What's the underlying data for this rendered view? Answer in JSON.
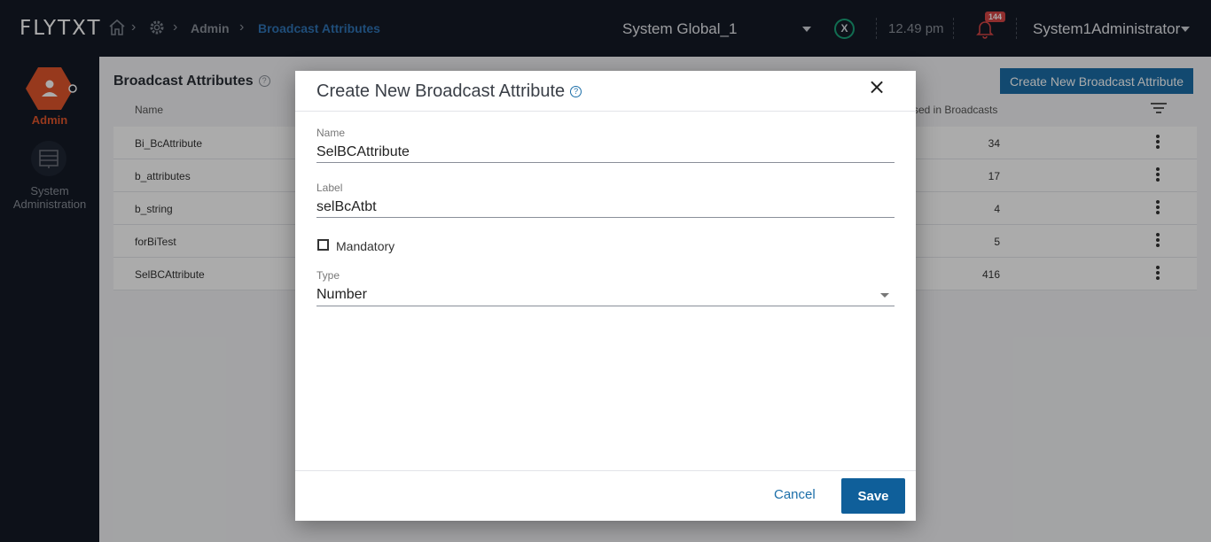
{
  "header": {
    "logo": "FLYTXT",
    "breadcrumb": {
      "admin": "Admin",
      "current": "Broadcast Attributes"
    },
    "tenant": "System Global_1",
    "status_badge": "X",
    "time": "12.49 pm",
    "notification_count": "144",
    "user": "System1Administrator"
  },
  "sidebar": {
    "items": [
      {
        "label": "Admin"
      },
      {
        "label": "System Administration"
      }
    ]
  },
  "page": {
    "title": "Broadcast Attributes",
    "help": "?",
    "create_button": "Create New Broadcast Attribute",
    "columns": {
      "name": "Name",
      "used_in": "sed in Broadcasts"
    },
    "rows": [
      {
        "name": "Bi_BcAttribute",
        "count": "34"
      },
      {
        "name": "b_attributes",
        "count": "17"
      },
      {
        "name": "b_string",
        "count": "4"
      },
      {
        "name": "forBiTest",
        "count": "5"
      },
      {
        "name": "SelBCAttribute",
        "count": "416"
      }
    ]
  },
  "modal": {
    "title": "Create New Broadcast Attribute",
    "help": "?",
    "close": "×",
    "name_label": "Name",
    "name_value": "SelBCAttribute",
    "label_label": "Label",
    "label_value": "selBcAtbt",
    "mandatory_label": "Mandatory",
    "mandatory_checked": false,
    "type_label": "Type",
    "type_value": "Number",
    "cancel": "Cancel",
    "save": "Save"
  },
  "colors": {
    "topbar": "#141a26",
    "accent": "#1b6ea8",
    "admin": "#e2562c",
    "badge": "#d64545"
  }
}
